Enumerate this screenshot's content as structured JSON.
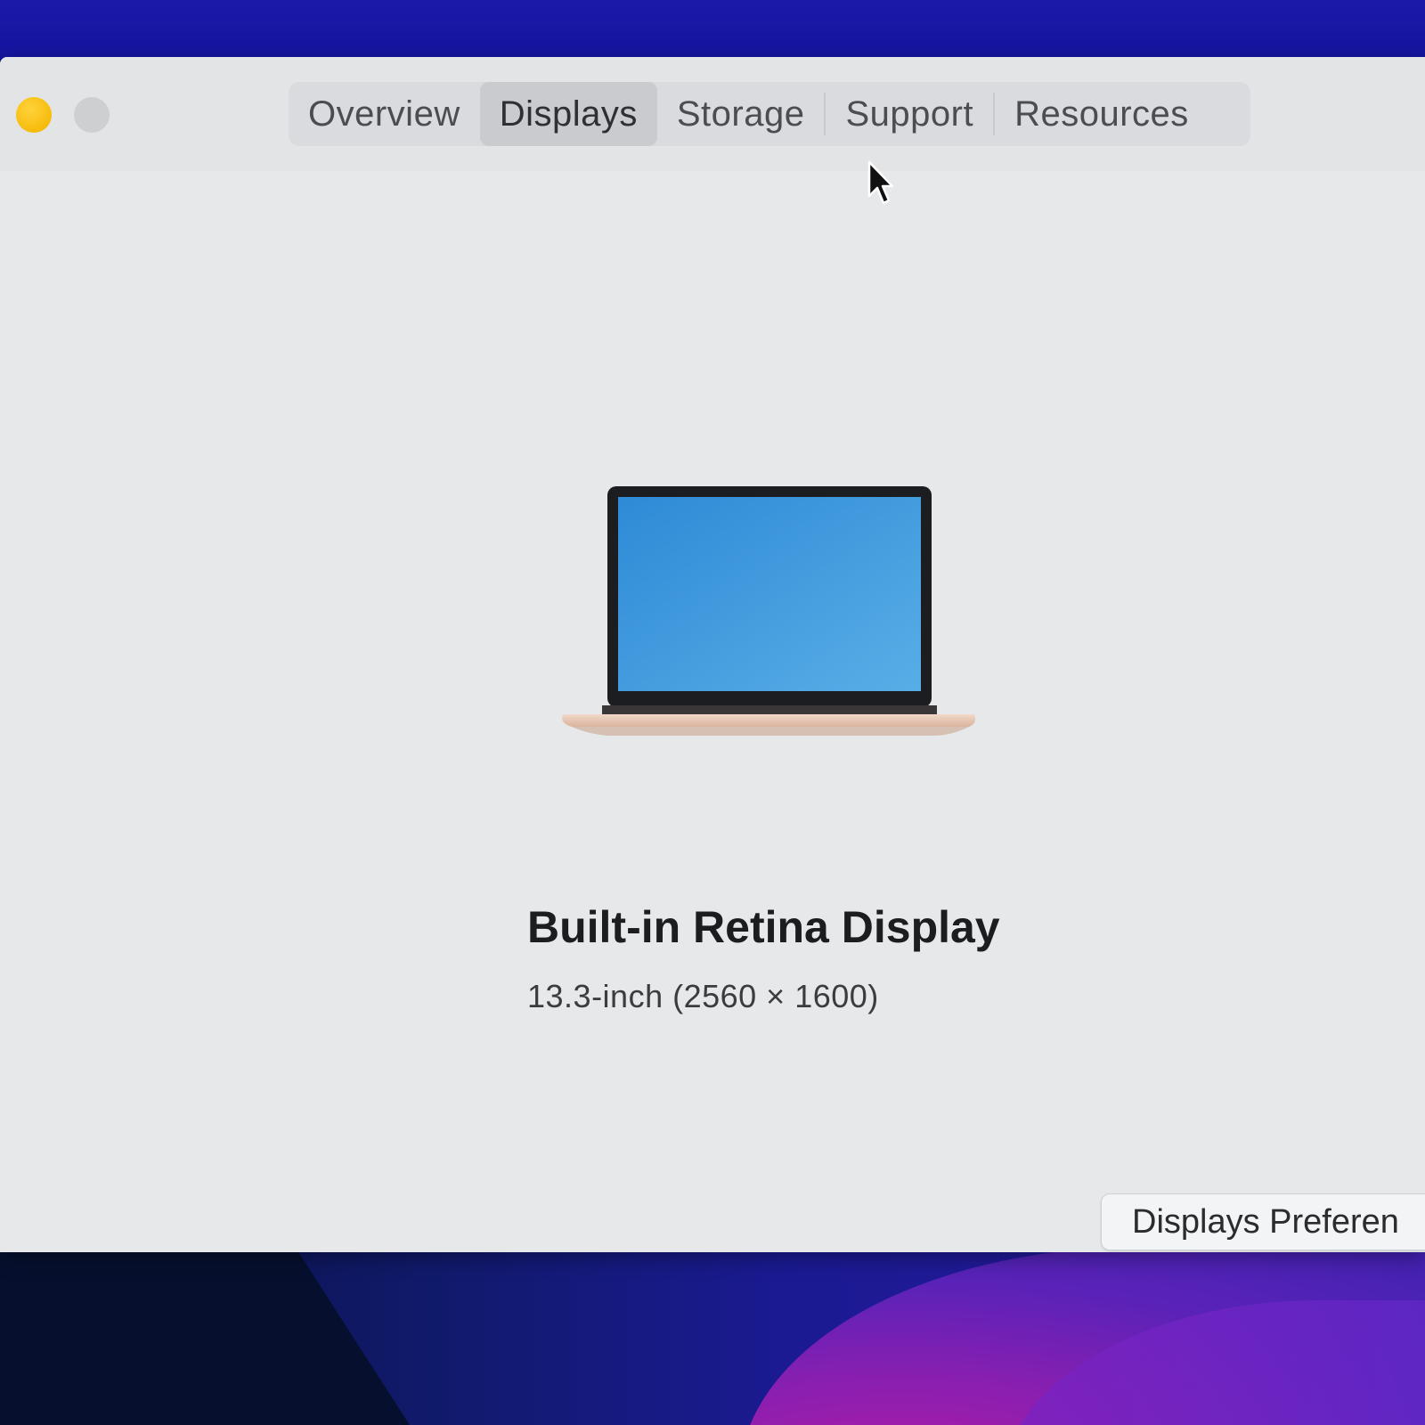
{
  "window": {
    "tabs": [
      {
        "label": "Overview",
        "selected": false
      },
      {
        "label": "Displays",
        "selected": true
      },
      {
        "label": "Storage",
        "selected": false
      },
      {
        "label": "Support",
        "selected": false
      },
      {
        "label": "Resources",
        "selected": false
      }
    ]
  },
  "display": {
    "name": "Built-in Retina Display",
    "spec": "13.3-inch (2560 × 1600)"
  },
  "actions": {
    "preferences_button": "Displays Preferen"
  },
  "icons": {
    "device": "laptop-icon",
    "pointer": "mouse-cursor-icon"
  },
  "colors": {
    "accent_yellow": "#f6bc0c",
    "screen_blue": "#3e96da",
    "laptop_body": "#e9c9b4"
  }
}
